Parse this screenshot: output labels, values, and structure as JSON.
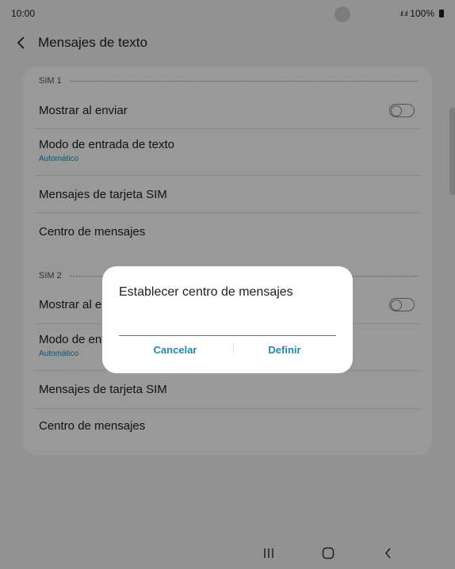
{
  "status_bar": {
    "time": "10:00",
    "signal": ".ıl .ıl",
    "battery": "100%"
  },
  "app_bar": {
    "title": "Mensajes de texto"
  },
  "sim1": {
    "header": "SIM 1",
    "show_when_sending": {
      "label": "Mostrar al enviar",
      "enabled": false
    },
    "input_mode": {
      "label": "Modo de entrada de texto",
      "value": "Automático"
    },
    "sim_messages": {
      "label": "Mensajes de tarjeta SIM"
    },
    "message_center": {
      "label": "Centro de mensajes"
    }
  },
  "sim2": {
    "header": "SIM 2",
    "show_when_sending": {
      "label": "Mostrar al enviar",
      "enabled": false
    },
    "input_mode": {
      "label": "Modo de entrada de texto",
      "value": "Automático"
    },
    "sim_messages": {
      "label": "Mensajes de tarjeta SIM"
    },
    "message_center": {
      "label": "Centro de mensajes"
    }
  },
  "dialog": {
    "title": "Establecer centro de mensajes",
    "input_value": "",
    "cancel_label": "Cancelar",
    "confirm_label": "Definir"
  },
  "colors": {
    "accent": "#1b8db0",
    "overlay": "rgba(0,0,0,0.40)"
  }
}
